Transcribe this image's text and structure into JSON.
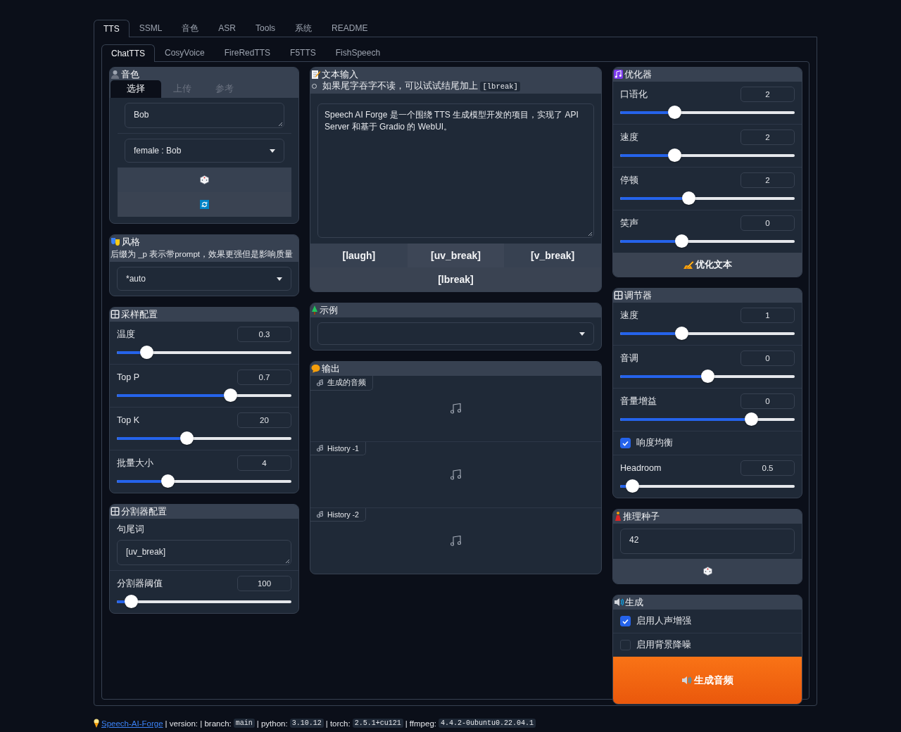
{
  "top_tabs": [
    {
      "label": "TTS",
      "selected": true
    },
    {
      "label": "SSML",
      "selected": false
    },
    {
      "label": "音色",
      "selected": false
    },
    {
      "label": "ASR",
      "selected": false
    },
    {
      "label": "Tools",
      "selected": false
    },
    {
      "label": "系统",
      "selected": false
    },
    {
      "label": "README",
      "selected": false
    }
  ],
  "sub_tabs": [
    {
      "label": "ChatTTS",
      "selected": true
    },
    {
      "label": "CosyVoice",
      "selected": false
    },
    {
      "label": "FireRedTTS",
      "selected": false
    },
    {
      "label": "F5TTS",
      "selected": false
    },
    {
      "label": "FishSpeech",
      "selected": false
    }
  ],
  "columns": [
    {
      "panels": [
        {
          "kind": "voice",
          "title": "音色",
          "tabs": [
            {
              "label": "选择",
              "selected": true
            },
            {
              "label": "上传",
              "selected": false
            },
            {
              "label": "参考",
              "selected": false
            }
          ],
          "items": [
            {
              "kind": "textbox",
              "value": "Bob"
            },
            {
              "kind": "dropdown",
              "value": "female : Bob"
            },
            {
              "kind": "dice_button"
            },
            {
              "kind": "refresh_button"
            }
          ]
        },
        {
          "kind": "style",
          "title": "风格",
          "note": "后缀为 _p 表示带prompt，效果更强但是影响质量",
          "items": [
            {
              "kind": "dropdown",
              "value": "*auto"
            }
          ]
        },
        {
          "kind": "config",
          "title": "采样配置",
          "items": [
            {
              "kind": "slider",
              "label": "温度",
              "value": "0.3",
              "level": 0.17
            },
            {
              "kind": "slider",
              "label": "Top P",
              "value": "0.7",
              "level": 0.65
            },
            {
              "kind": "slider",
              "label": "Top K",
              "value": "20",
              "level": 0.4
            },
            {
              "kind": "slider",
              "label": "批量大小",
              "value": "4",
              "level": 0.29
            }
          ]
        },
        {
          "kind": "config",
          "title": "分割器配置",
          "items": [
            {
              "kind": "textbox",
              "label": "句尾词",
              "value": "[uv_break]"
            },
            {
              "kind": "slider",
              "label": "分割器阈值",
              "value": "100",
              "level": 0.08
            }
          ]
        }
      ]
    },
    {
      "panels": [
        {
          "kind": "text_input",
          "title": "文本输入",
          "hint": {
            "text": "如果尾字吞字不读，可以试试结尾加上",
            "code": "[lbreak]"
          },
          "items": [
            {
              "kind": "textarea",
              "value": "Speech AI Forge 是一个围绕 TTS 生成模型开发的项目，实现了 API Server 和基于 Gradio 的 WebUI。"
            },
            {
              "kind": "button_grid",
              "buttons": [
                "[laugh]",
                "[uv_break]",
                "[v_break]",
                "[lbreak]"
              ]
            }
          ]
        },
        {
          "kind": "examples",
          "title": "示例",
          "items": [
            {
              "kind": "dropdown"
            }
          ]
        },
        {
          "kind": "output",
          "title": "输出",
          "items": [
            {
              "kind": "audio",
              "label": "生成的音频"
            },
            {
              "kind": "audio",
              "label": "History -1"
            },
            {
              "kind": "audio",
              "label": "History -2"
            }
          ]
        }
      ]
    },
    {
      "panels": [
        {
          "kind": "optimizer",
          "title": "优化器",
          "items": [
            {
              "kind": "slider",
              "label": "口语化",
              "value": "2",
              "level": 0.31
            },
            {
              "kind": "slider",
              "label": "速度",
              "value": "2",
              "level": 0.31
            },
            {
              "kind": "slider",
              "label": "停顿",
              "value": "2",
              "level": 0.39
            },
            {
              "kind": "slider",
              "label": "笑声",
              "value": "0",
              "level": 0.35
            },
            {
              "kind": "optimize_button",
              "label": "优化文本"
            }
          ]
        },
        {
          "kind": "config",
          "title": "调节器",
          "items": [
            {
              "kind": "slider",
              "label": "速度",
              "value": "1",
              "level": 0.35
            },
            {
              "kind": "slider",
              "label": "音调",
              "value": "0",
              "level": 0.5
            },
            {
              "kind": "slider",
              "label": "音量增益",
              "value": "0",
              "level": 0.75
            },
            {
              "kind": "checkbox",
              "label": "响度均衡",
              "checked": true
            },
            {
              "kind": "slider",
              "label": "Headroom",
              "value": "0.5",
              "level": 0.07
            }
          ]
        },
        {
          "kind": "seed",
          "title": "推理种子",
          "items": [
            {
              "kind": "seed_field",
              "value": "42"
            },
            {
              "kind": "dice_button"
            }
          ]
        },
        {
          "kind": "generate",
          "title": "生成",
          "items": [
            {
              "kind": "checkbox",
              "label": "启用人声增强",
              "checked": true
            },
            {
              "kind": "checkbox",
              "label": "启用背景降噪",
              "checked": false
            },
            {
              "kind": "generate_button",
              "label": "生成音频"
            }
          ]
        }
      ]
    }
  ],
  "footer": [
    {
      "kind": "link",
      "text": "Speech-AI-Forge"
    },
    {
      "kind": "text",
      "text": "| version: | branch:"
    },
    {
      "kind": "code",
      "text": "main"
    },
    {
      "kind": "text",
      "text": "| python:"
    },
    {
      "kind": "code",
      "text": "3.10.12"
    },
    {
      "kind": "text",
      "text": "| torch:"
    },
    {
      "kind": "code",
      "text": "2.5.1+cu121"
    },
    {
      "kind": "text",
      "text": "| ffmpeg:"
    },
    {
      "kind": "code",
      "text": "4.4.2-0ubuntu0.22.04.1"
    }
  ]
}
